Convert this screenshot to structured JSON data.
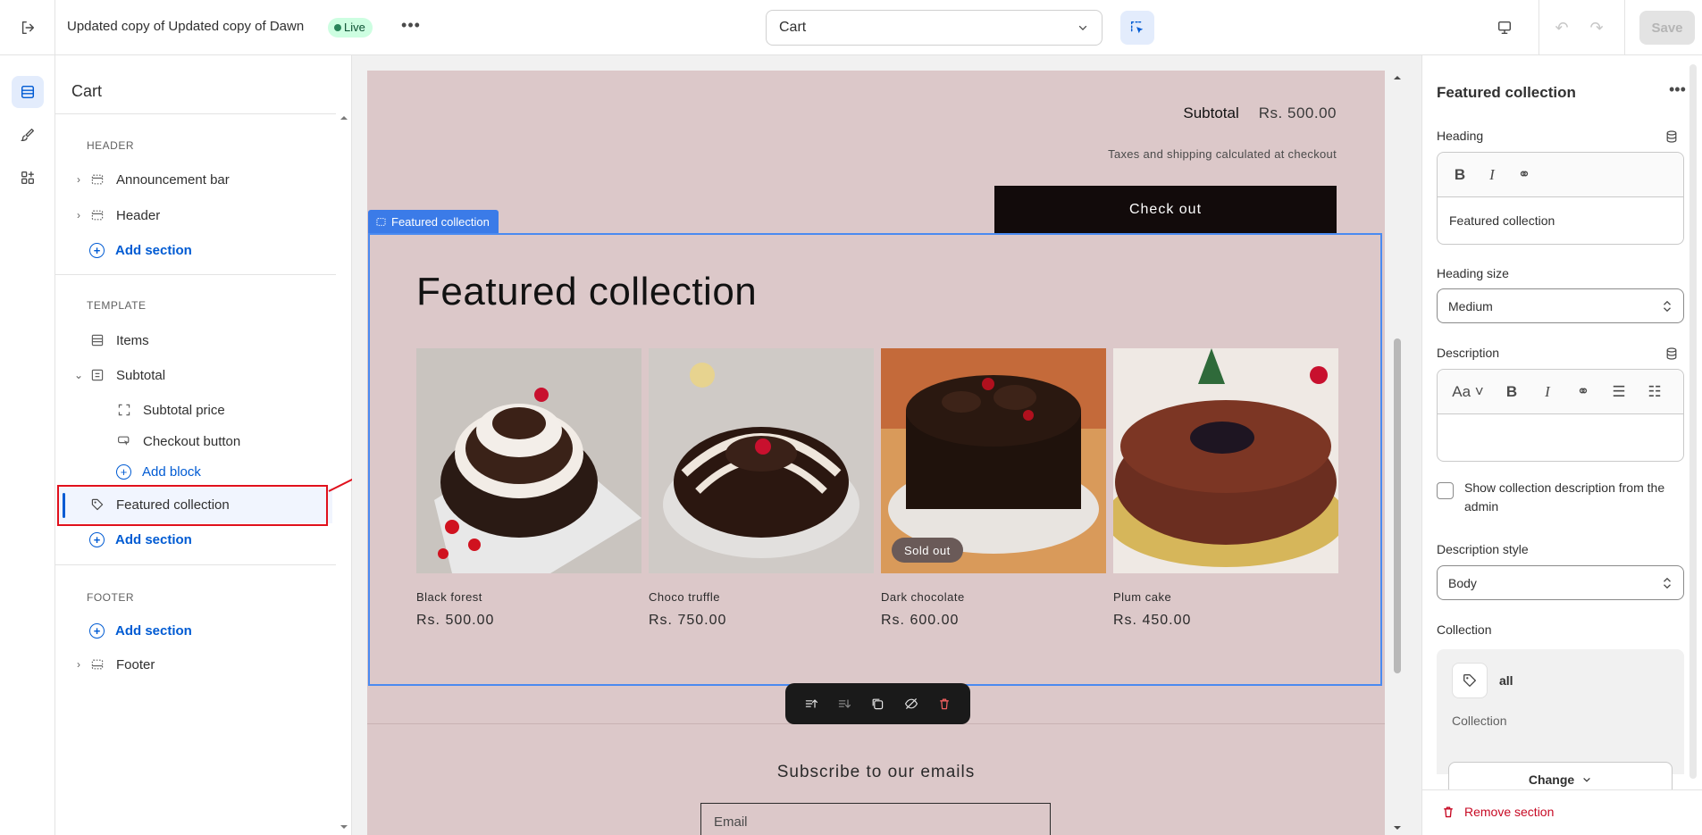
{
  "topbar": {
    "theme_name": "Updated copy of Updated copy of Dawn",
    "status_badge": "Live",
    "page_selector": "Cart",
    "save_label": "Save"
  },
  "left_panel": {
    "title": "Cart",
    "header_group": "HEADER",
    "template_group": "TEMPLATE",
    "footer_group": "FOOTER",
    "items": {
      "announcement_bar": "Announcement bar",
      "header": "Header",
      "items": "Items",
      "subtotal": "Subtotal",
      "subtotal_price": "Subtotal price",
      "checkout_button": "Checkout button",
      "add_block": "Add block",
      "featured_collection": "Featured collection",
      "footer": "Footer"
    },
    "add_section": "Add section"
  },
  "preview": {
    "subtotal_label": "Subtotal",
    "subtotal_value": "Rs. 500.00",
    "taxes_note": "Taxes and shipping calculated at checkout",
    "checkout_label": "Check out",
    "section_tag": "Featured collection",
    "heading": "Featured collection",
    "products": [
      {
        "name": "Black forest",
        "price": "Rs. 500.00"
      },
      {
        "name": "Choco truffle",
        "price": "Rs. 750.00"
      },
      {
        "name": "Dark chocolate",
        "price": "Rs. 600.00",
        "badge": "Sold out"
      },
      {
        "name": "Plum cake",
        "price": "Rs. 450.00"
      }
    ],
    "subscribe_heading": "Subscribe to our emails",
    "email_placeholder": "Email"
  },
  "right_panel": {
    "title": "Featured collection",
    "heading_label": "Heading",
    "heading_value": "Featured collection",
    "heading_size_label": "Heading size",
    "heading_size_value": "Medium",
    "description_label": "Description",
    "show_description_label": "Show collection description from the admin",
    "description_style_label": "Description style",
    "description_style_value": "Body",
    "collection_label": "Collection",
    "collection_name": "all",
    "collection_sub": "Collection",
    "change_label": "Change",
    "remove_label": "Remove section"
  },
  "colors": {
    "accent": "#005bd3",
    "store_bg": "#dcc8c9",
    "danger": "#c70a24"
  }
}
